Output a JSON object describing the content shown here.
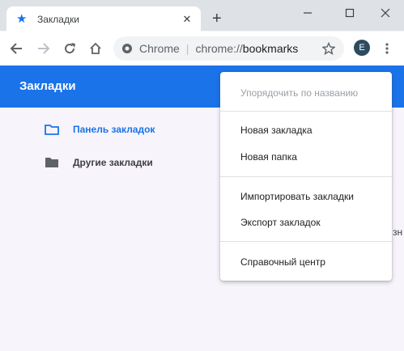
{
  "tab": {
    "title": "Закладки",
    "close_glyph": "✕",
    "new_tab_glyph": "+"
  },
  "window": {
    "minimize": "minimize-icon",
    "maximize": "maximize-icon",
    "close": "close-icon"
  },
  "omnibox": {
    "scheme": "Chrome",
    "url_prefix": "chrome://",
    "url_host": "bookmarks"
  },
  "profile": {
    "initial": "E"
  },
  "header": {
    "title": "Закладки"
  },
  "folders": [
    {
      "label": "Панель закладок",
      "selected": true
    },
    {
      "label": "Другие закладки",
      "selected": false
    }
  ],
  "stray_text": "зн",
  "menu": {
    "sort": "Упорядочить по названию",
    "new_bookmark": "Новая закладка",
    "new_folder": "Новая папка",
    "import": "Импортировать закладки",
    "export": "Экспорт закладок",
    "help": "Справочный центр"
  },
  "colors": {
    "accent": "#1a73e8",
    "titlebar": "#dee1e6",
    "background": "#f8f4fb"
  }
}
